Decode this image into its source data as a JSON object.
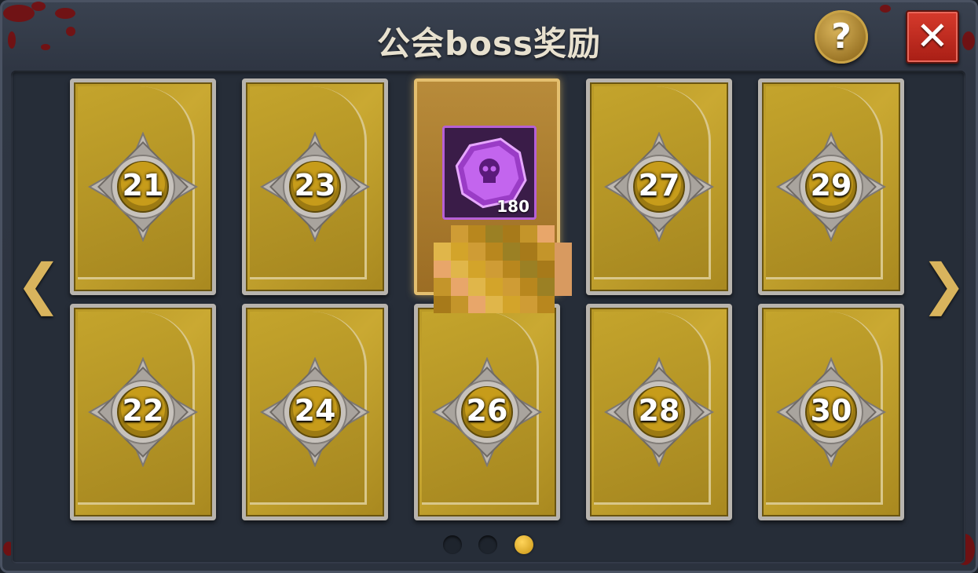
{
  "dialog": {
    "title": "公会boss奖励",
    "help_label": "?",
    "close_label": "✕",
    "prev_label": "❮",
    "next_label": "❯"
  },
  "cards": [
    {
      "number": "21",
      "state": "locked"
    },
    {
      "number": "23",
      "state": "locked"
    },
    {
      "number": "",
      "state": "opened",
      "reward": {
        "icon": "purple-skull-gem-icon",
        "count": "180"
      }
    },
    {
      "number": "27",
      "state": "locked"
    },
    {
      "number": "29",
      "state": "locked"
    },
    {
      "number": "22",
      "state": "locked"
    },
    {
      "number": "24",
      "state": "locked"
    },
    {
      "number": "26",
      "state": "locked"
    },
    {
      "number": "28",
      "state": "locked"
    },
    {
      "number": "30",
      "state": "locked"
    }
  ],
  "pagination": {
    "pages": 3,
    "current_page": 3
  },
  "colors": {
    "accent_gold": "#d9b45d",
    "close_red": "#c62d22",
    "reward_purple": "#b660d6"
  }
}
